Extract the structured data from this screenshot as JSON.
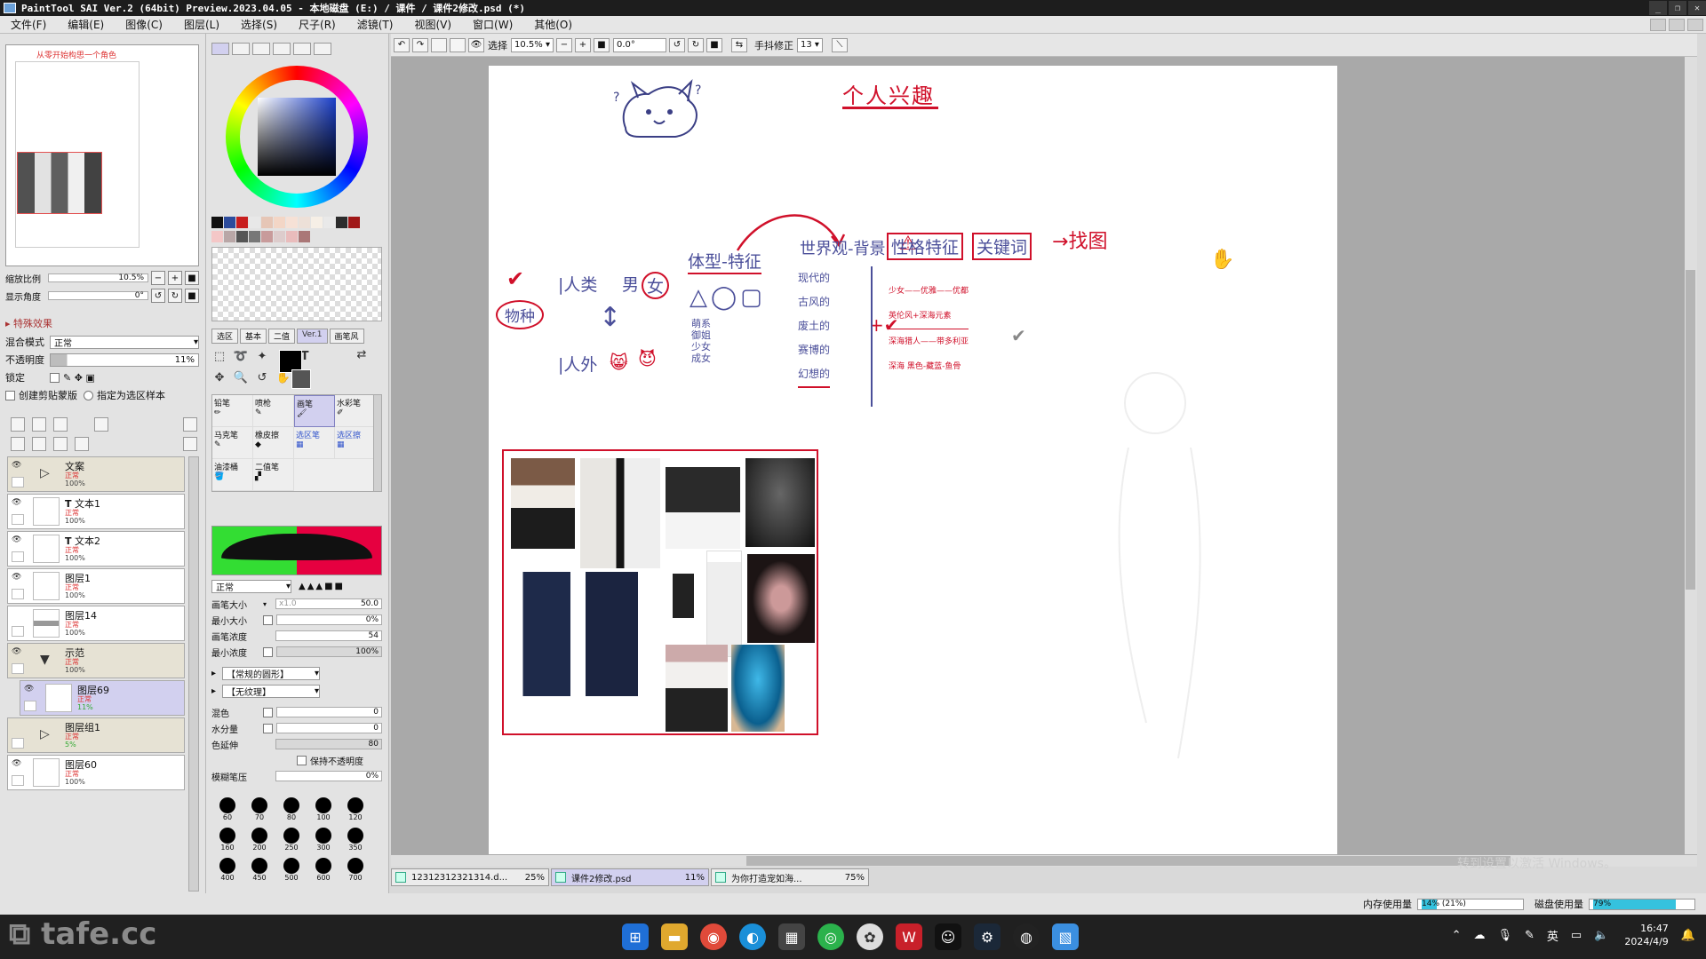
{
  "window": {
    "title": "PaintTool SAI Ver.2 (64bit) Preview.2023.04.05 - 本地磁盘 (E:) / 课件 / 课件2修改.psd (*)",
    "controls": [
      "_",
      "❐",
      "✕"
    ]
  },
  "menu": [
    "文件(F)",
    "编辑(E)",
    "图像(C)",
    "图层(L)",
    "选择(S)",
    "尺子(R)",
    "滤镜(T)",
    "视图(V)",
    "窗口(W)",
    "其他(O)"
  ],
  "navigator": {
    "thumb_title": "从零开始构思一个角色",
    "zoom_label": "缩放比例",
    "zoom_value": "10.5%",
    "angle_label": "显示角度",
    "angle_value": "0°"
  },
  "layer_props": {
    "effects_label": "特殊效果",
    "blend_label": "混合模式",
    "blend_value": "正常",
    "opacity_label": "不透明度",
    "opacity_value": "11%",
    "lock_label": "锁定",
    "clip_label": "创建剪贴蒙版",
    "sample_label": "指定为选区样本"
  },
  "layers": [
    {
      "name": "文案",
      "mode": "正常",
      "opacity": "100%",
      "type": "folder",
      "visible": true
    },
    {
      "name": "文本1",
      "mode": "正常",
      "opacity": "100%",
      "type": "text",
      "visible": true
    },
    {
      "name": "文本2",
      "mode": "正常",
      "opacity": "100%",
      "type": "text",
      "visible": true
    },
    {
      "name": "图层1",
      "mode": "正常",
      "opacity": "100%",
      "type": "layer",
      "visible": true
    },
    {
      "name": "图层14",
      "mode": "正常",
      "opacity": "100%",
      "type": "layer",
      "visible": false
    },
    {
      "name": "示范",
      "mode": "正常",
      "opacity": "100%",
      "type": "folder-open",
      "visible": true
    },
    {
      "name": "图层69",
      "mode": "正常",
      "opacity": "11%",
      "type": "layer-selected",
      "visible": true
    },
    {
      "name": "图层组1",
      "mode": "正常",
      "opacity": "5%",
      "type": "folder",
      "visible": false
    },
    {
      "name": "图层60",
      "mode": "正常",
      "opacity": "100%",
      "type": "layer",
      "visible": true
    }
  ],
  "tool_tabs": [
    "选区",
    "基本",
    "二值",
    "Ver.1",
    "画笔风"
  ],
  "brushes": [
    {
      "label": "铅笔"
    },
    {
      "label": "喷枪"
    },
    {
      "label": "画笔"
    },
    {
      "label": "水彩笔"
    },
    {
      "label": "马克笔"
    },
    {
      "label": "橡皮擦"
    },
    {
      "label": "选区笔"
    },
    {
      "label": "选区擦"
    },
    {
      "label": "油漆桶"
    },
    {
      "label": "二值笔"
    }
  ],
  "brush_props": {
    "mode_value": "正常",
    "size_label": "画笔大小",
    "size_mult": "x1.0",
    "size_value": "50.0",
    "min_size_label": "最小大小",
    "min_size_value": "0%",
    "density_label": "画笔浓度",
    "density_value": "54",
    "min_density_label": "最小浓度",
    "min_density_value": "100%",
    "shape_value": "【常规的圆形】",
    "texture_value": "【无纹理】",
    "mix_label": "混色",
    "mix_value": "0",
    "water_label": "水分量",
    "water_value": "0",
    "stretch_label": "色延伸",
    "stretch_value": "80",
    "keep_opacity_label": "保持不透明度",
    "pressure_label": "模糊笔压",
    "pressure_value": "0%"
  },
  "brush_sizes": [
    "60",
    "70",
    "80",
    "100",
    "120",
    "160",
    "200",
    "250",
    "300",
    "350",
    "400",
    "450",
    "500",
    "600",
    "700"
  ],
  "canvas_toolbar": {
    "select_label": "选择",
    "zoom": "10.5%",
    "angle": "0.0°",
    "stabilizer_label": "手抖修正",
    "stabilizer_value": "13"
  },
  "sketch": {
    "title": "个人兴趣",
    "species": "物种",
    "human": "人类",
    "male": "男",
    "female": "女",
    "nonhuman": "人外",
    "body": "体型-特征",
    "body_types": [
      "萌系",
      "御姐",
      "少女",
      "成女"
    ],
    "world": "世界观-背景",
    "world_items": [
      "现代的",
      "古风的",
      "废土的",
      "赛博的",
      "幻想的"
    ],
    "personality": "性格特征",
    "keywords": "关键词",
    "ref": "找图",
    "notes": [
      "少女——优雅——优都",
      "英伦风+深海元素",
      "深海猎人——带多利亚",
      "深海 黑色-藏蓝-鱼骨"
    ]
  },
  "doc_tabs": [
    {
      "name": "12312312321314.d...",
      "zoom": "25%"
    },
    {
      "name": "课件2修改.psd",
      "zoom": "11%"
    },
    {
      "name": "为你打造宠如海...",
      "zoom": "75%"
    }
  ],
  "status": {
    "memory_label": "内存使用量",
    "memory_value": "14% (21%)",
    "memory_fraction": 0.14,
    "disk_label": "磁盘使用量",
    "disk_value": "79%",
    "disk_fraction": 0.79
  },
  "watermark": "tafe.cc",
  "activation_text": "转到设置以激活 Windows。",
  "clock": {
    "time": "16:47",
    "date": "2024/4/9"
  },
  "tray_lang": "英"
}
